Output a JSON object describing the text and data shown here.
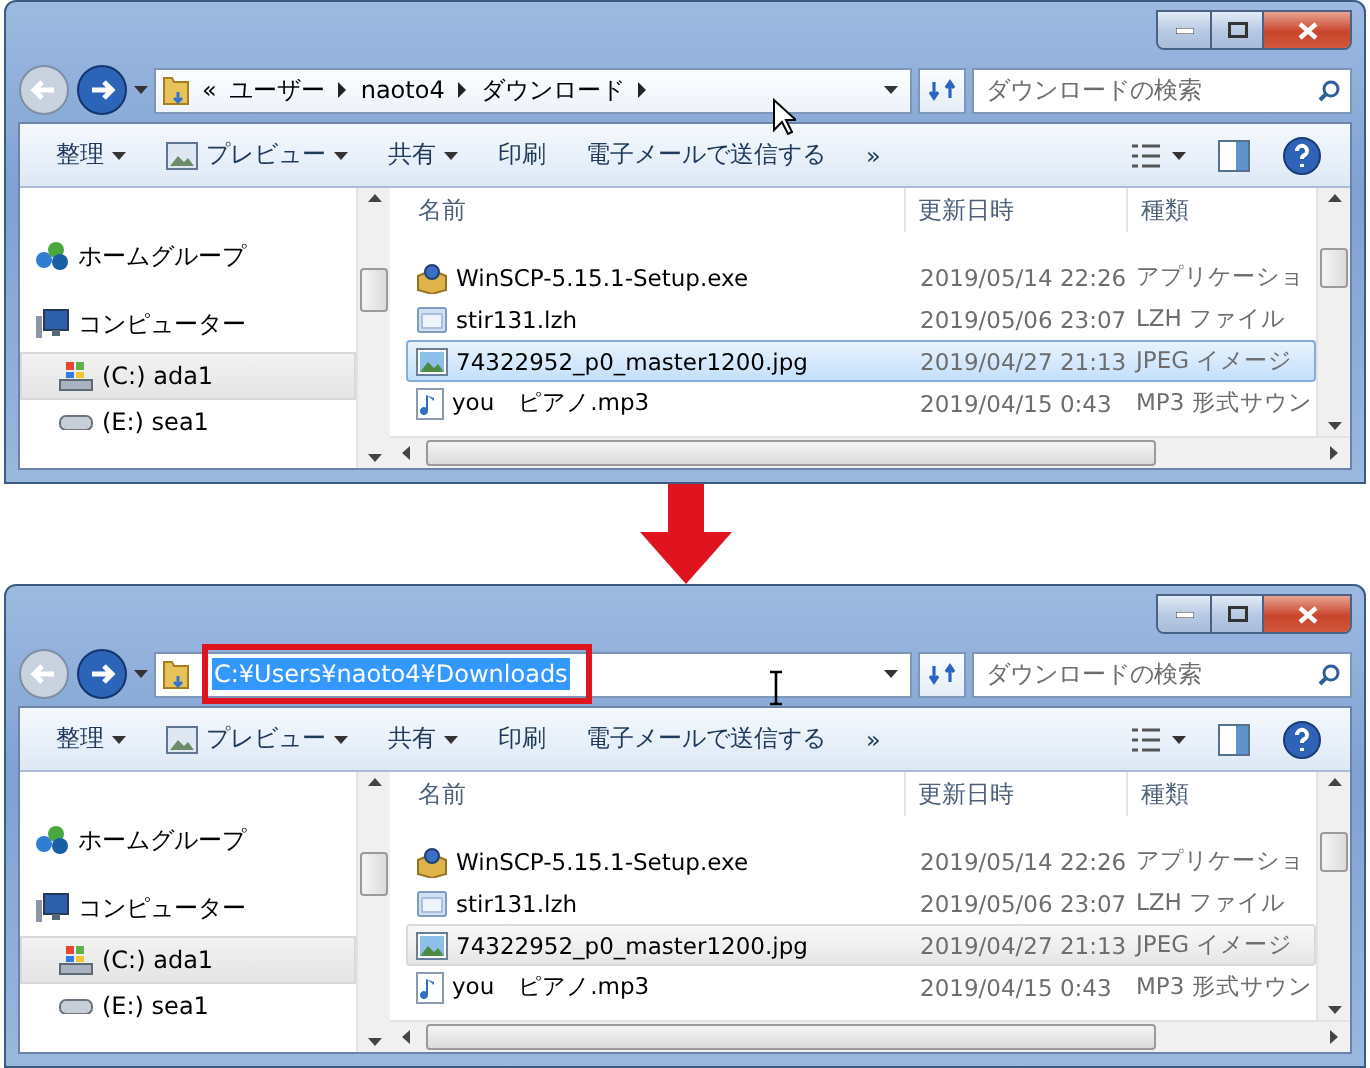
{
  "windows": [
    {
      "address": {
        "kind": "breadcrumb",
        "segments": [
          "«",
          "ユーザー",
          "naoto4",
          "ダウンロード"
        ],
        "highlighted": false
      },
      "cursor": {
        "kind": "arrow"
      },
      "selection_active": true,
      "search": {
        "placeholder": "ダウンロードの検索"
      },
      "toolbar": [
        {
          "label": "整理",
          "dropdown": true,
          "icon": false
        },
        {
          "label": "プレビュー",
          "dropdown": true,
          "icon": true
        },
        {
          "label": "共有",
          "dropdown": true,
          "icon": false
        },
        {
          "label": "印刷",
          "dropdown": false,
          "icon": false
        },
        {
          "label": "電子メールで送信する",
          "dropdown": false,
          "icon": false
        },
        {
          "label": "»",
          "dropdown": false,
          "icon": false
        }
      ],
      "nav": [
        {
          "label": "ホームグループ",
          "kind": "homegroup",
          "selected": false
        },
        {
          "label": "コンピューター",
          "kind": "computer",
          "selected": false
        },
        {
          "label": "(C:) ada1",
          "kind": "drive",
          "selected": true
        },
        {
          "label": "(E:) sea1",
          "kind": "disk",
          "selected": false
        }
      ],
      "columns": [
        "名前",
        "更新日時",
        "種類"
      ],
      "rows": [
        {
          "name": "WinSCP-5.15.1-Setup.exe",
          "date": "2019/05/14 22:26",
          "type": "アプリケーショ",
          "kind": "exe",
          "selected": false
        },
        {
          "name": "stir131.lzh",
          "date": "2019/05/06 23:07",
          "type": "LZH ファイル",
          "kind": "archive",
          "selected": false
        },
        {
          "name": "74322952_p0_master1200.jpg",
          "date": "2019/04/27 21:13",
          "type": "JPEG イメージ",
          "kind": "image",
          "selected": true
        },
        {
          "name": "you　ピアノ.mp3",
          "date": "2019/04/15 0:43",
          "type": "MP3 形式サウン",
          "kind": "audio",
          "selected": false
        }
      ]
    },
    {
      "address": {
        "kind": "path",
        "value": "C:¥Users¥naoto4¥Downloads",
        "highlighted": true
      },
      "cursor": {
        "kind": "text"
      },
      "selection_active": false,
      "search": {
        "placeholder": "ダウンロードの検索"
      },
      "toolbar": [
        {
          "label": "整理",
          "dropdown": true,
          "icon": false
        },
        {
          "label": "プレビュー",
          "dropdown": true,
          "icon": true
        },
        {
          "label": "共有",
          "dropdown": true,
          "icon": false
        },
        {
          "label": "印刷",
          "dropdown": false,
          "icon": false
        },
        {
          "label": "電子メールで送信する",
          "dropdown": false,
          "icon": false
        },
        {
          "label": "»",
          "dropdown": false,
          "icon": false
        }
      ],
      "nav": [
        {
          "label": "ホームグループ",
          "kind": "homegroup",
          "selected": false
        },
        {
          "label": "コンピューター",
          "kind": "computer",
          "selected": false
        },
        {
          "label": "(C:) ada1",
          "kind": "drive",
          "selected": true
        },
        {
          "label": "(E:) sea1",
          "kind": "disk",
          "selected": false
        }
      ],
      "columns": [
        "名前",
        "更新日時",
        "種類"
      ],
      "rows": [
        {
          "name": "WinSCP-5.15.1-Setup.exe",
          "date": "2019/05/14 22:26",
          "type": "アプリケーショ",
          "kind": "exe",
          "selected": false
        },
        {
          "name": "stir131.lzh",
          "date": "2019/05/06 23:07",
          "type": "LZH ファイル",
          "kind": "archive",
          "selected": false
        },
        {
          "name": "74322952_p0_master1200.jpg",
          "date": "2019/04/27 21:13",
          "type": "JPEG イメージ",
          "kind": "image",
          "selected": true
        },
        {
          "name": "you　ピアノ.mp3",
          "date": "2019/04/15 0:43",
          "type": "MP3 形式サウン",
          "kind": "audio",
          "selected": false
        }
      ]
    }
  ]
}
